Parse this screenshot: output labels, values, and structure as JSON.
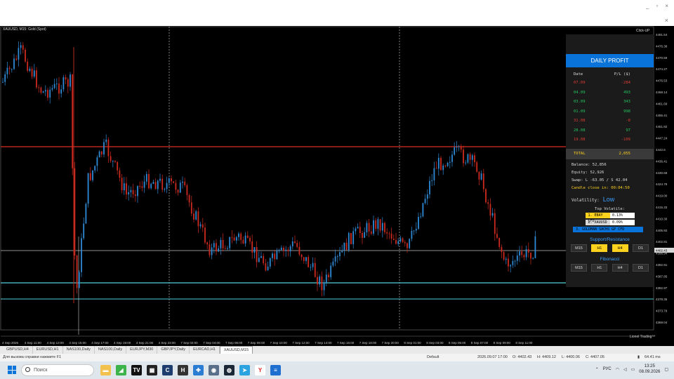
{
  "window": {
    "minimize": "_",
    "restore": "▫",
    "close": "×",
    "sub_close": "×"
  },
  "chart": {
    "symbol_label": "XAUUSD, M15: Gold (Spot)",
    "clickup_label": "Click-UP",
    "brand_label": "Lionel Trading™",
    "price_axis": [
      "4481.54",
      "4476.38",
      "4470.59",
      "4474.27",
      "4476.53",
      "4468.14",
      "4461.69",
      "4455.41",
      "4451.82",
      "4447.24",
      "4442.6",
      "4436.41",
      "4430.68",
      "4424.79",
      "4419.00",
      "4415.33",
      "4410.30",
      "4405.92",
      "4402.81",
      "4398.94",
      "4392.91",
      "4387.85",
      "4382.97",
      "4378.35",
      "4373.79",
      "4369.04"
    ],
    "price_marker": "4402.43",
    "time_axis": [
      "4 Sep 2026",
      "4 Sep 11:00",
      "4 Sep 13:00",
      "4 Sep 15:00",
      "4 Sep 17:00",
      "4 Sep 19:00",
      "4 Sep 21:00",
      "4 Sep 23:00",
      "7 Sep 02:00",
      "7 Sep 04:00",
      "7 Sep 06:00",
      "7 Sep 08:00",
      "7 Sep 10:00",
      "7 Sep 12:00",
      "7 Sep 14:00",
      "7 Sep 16:00",
      "7 Sep 18:00",
      "7 Sep 20:00",
      "8 Sep 01:00",
      "8 Sep 03:00",
      "8 Sep 05:00",
      "8 Sep 07:00",
      "8 Sep 09:00",
      "8 Sep 11:00"
    ],
    "colors": {
      "bull": "#2f8ad6",
      "bear": "#cc2a1f",
      "resistance": "#b5271d",
      "support": "#4fd0d8",
      "price_line": "#bfbfbf"
    }
  },
  "panel": {
    "title": "DAILY PROFIT",
    "col_date": "Date",
    "col_pl": "P/L ($)",
    "rows": [
      {
        "date": "07.09",
        "pl": "-284",
        "tone": "red"
      },
      {
        "date": "04.09",
        "pl": "493",
        "tone": "green"
      },
      {
        "date": "03.09",
        "pl": "343",
        "tone": "green"
      },
      {
        "date": "01.09",
        "pl": "998",
        "tone": "green"
      },
      {
        "date": "31.08",
        "pl": "-8",
        "tone": "red"
      },
      {
        "date": "28.08",
        "pl": "97",
        "tone": "green"
      },
      {
        "date": "19.08",
        "pl": "-109",
        "tone": "red"
      }
    ],
    "total_label": "TOTAL",
    "total_value": "2,055",
    "balance": "Balance: 52,856",
    "equity": "Equity: 52,926",
    "swap": "Swap: L -63.05 / S 42.04",
    "candle_close": "Candle close in: 00:04:50",
    "volatility_label": "Volatility:",
    "volatility_value": "Low",
    "top_volatile_title": "Top Volatile:",
    "top_volatile": [
      {
        "name": "1. EBAY CFD",
        "pct": "0.13%",
        "color": "#ffd21e"
      },
      {
        "name": "2. XAUUSD",
        "pct": "0.09%",
        "color": "#d9d9d9"
      },
      {
        "name": "3. GOLDMAN SACHS GP CFD",
        "pct": "",
        "color": "#0a73d9"
      }
    ],
    "sr_title": "Support/Resistance",
    "sr_buttons": [
      "M15",
      "H1",
      "H4",
      "D1"
    ],
    "fib_title": "Fibonacci",
    "fib_buttons": [
      "M15",
      "H1",
      "H4",
      "D1"
    ]
  },
  "tabs": [
    "GBPUSD,H4",
    "EURUSD,H1",
    "NAS100,Daily",
    "NAS100,Daily",
    "EURJPY,M30",
    "GBPJPY,Daily",
    "EURCAD,H1",
    "XAUUSD,M15"
  ],
  "status": {
    "help": "Для вызова справки нажмите F1",
    "profile": "Default",
    "datetime": "2026.09.07 17:00",
    "open": "O: 4402.43",
    "high": "H: 4409.12",
    "low": "L: 4400.06",
    "close": "C: 4407.05",
    "ping": "64.41 ms"
  },
  "taskbar": {
    "search_placeholder": "Поиск",
    "lang": "РУС",
    "time": "13:25",
    "date": "08.09.2026",
    "apps": [
      {
        "name": "file-explorer",
        "glyph": "▬",
        "color": "#f2c14e"
      },
      {
        "name": "green-app",
        "glyph": "◢",
        "color": "#3cb44b"
      },
      {
        "name": "tradingview",
        "glyph": "TV",
        "color": "#111111"
      },
      {
        "name": "mt-app",
        "glyph": "▦",
        "color": "#222222"
      },
      {
        "name": "c-app",
        "glyph": "C",
        "color": "#1c3d6e"
      },
      {
        "name": "h-app",
        "glyph": "H",
        "color": "#333333"
      },
      {
        "name": "shield-app",
        "glyph": "✚",
        "color": "#2b7cd3"
      },
      {
        "name": "camera-app",
        "glyph": "◉",
        "color": "#5a6f8a"
      },
      {
        "name": "steam-app",
        "glyph": "◍",
        "color": "#1b2838"
      },
      {
        "name": "telegram-app",
        "glyph": "➤",
        "color": "#2aa3e0"
      },
      {
        "name": "yandex-app",
        "glyph": "Y",
        "color": "#ffffff"
      },
      {
        "name": "docs-app",
        "glyph": "≡",
        "color": "#1f6fd1"
      }
    ]
  }
}
